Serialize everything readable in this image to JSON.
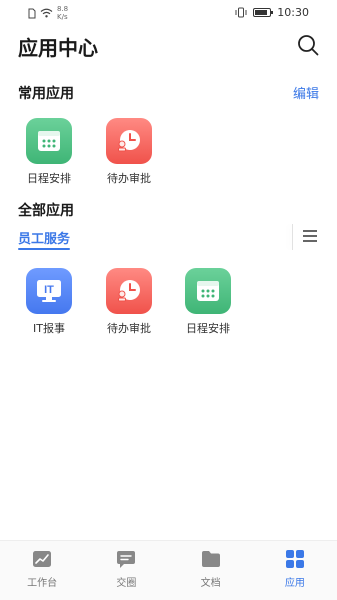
{
  "status_bar": {
    "net_speed_value": "8.8",
    "net_speed_unit": "K/s",
    "time": "10:30",
    "battery_level": 0.85
  },
  "header": {
    "title": "应用中心",
    "search_icon": "search-icon"
  },
  "frequent": {
    "title": "常用应用",
    "edit_label": "编辑",
    "apps": [
      {
        "label": "日程安排",
        "icon": "calendar-icon",
        "color": "#4cc183"
      },
      {
        "label": "待办审批",
        "icon": "clock-stamp-icon",
        "color": "#f45d55"
      }
    ]
  },
  "all_apps": {
    "title": "全部应用",
    "tabs": [
      {
        "label": "员工服务",
        "active": true
      }
    ],
    "menu_icon": "list-menu-icon",
    "apps": [
      {
        "label": "IT报事",
        "icon": "it-monitor-icon",
        "icon_text": "IT",
        "color": "#5584f5"
      },
      {
        "label": "待办审批",
        "icon": "clock-stamp-icon",
        "color": "#f45d55"
      },
      {
        "label": "日程安排",
        "icon": "calendar-icon",
        "color": "#4cc183"
      }
    ]
  },
  "bottom_nav": {
    "items": [
      {
        "label": "工作台",
        "icon": "chart-icon",
        "active": false
      },
      {
        "label": "交圈",
        "icon": "chat-icon",
        "active": false
      },
      {
        "label": "文档",
        "icon": "folder-icon",
        "active": false
      },
      {
        "label": "应用",
        "icon": "grid-icon",
        "active": true
      }
    ]
  },
  "colors": {
    "accent": "#3b78e7",
    "green": "#4cc183",
    "red": "#f45d55",
    "blue": "#5584f5"
  }
}
